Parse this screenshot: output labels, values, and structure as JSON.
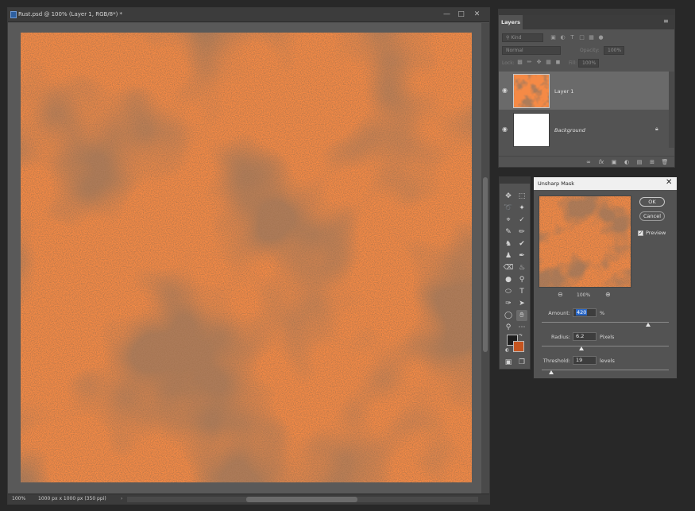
{
  "document": {
    "title": "Rust.psd @ 100% (Layer 1, RGB/8*) *",
    "zoom": "100%",
    "info": "1000 px x 1000 px (350 ppi)",
    "canvas_color": "#f58a46"
  },
  "layers_panel": {
    "tab": "Layers",
    "filter_placeholder": "Kind",
    "blend_mode": "Normal",
    "opacity_label": "Opacity:",
    "opacity_value": "100%",
    "lock_label": "Lock:",
    "fill_label": "Fill:",
    "fill_value": "100%",
    "layers": [
      {
        "name": "Layer 1",
        "selected": true,
        "italic": false
      },
      {
        "name": "Background",
        "selected": false,
        "italic": true,
        "locked": true
      }
    ]
  },
  "unsharp_mask": {
    "title": "Unsharp Mask",
    "ok": "OK",
    "cancel": "Cancel",
    "preview_label": "Preview",
    "preview_checked": true,
    "zoom": "100%",
    "amount_label": "Amount:",
    "amount_value": "420",
    "amount_unit": "%",
    "amount_fraction": 0.84,
    "radius_label": "Radius:",
    "radius_value": "6.2",
    "radius_unit": "Pixels",
    "radius_fraction": 0.31,
    "threshold_label": "Threshold:",
    "threshold_value": "19",
    "threshold_unit": "levels",
    "threshold_fraction": 0.075
  },
  "tool_colors": {
    "foreground": "#1e1e1e",
    "background": "#c4541f"
  }
}
